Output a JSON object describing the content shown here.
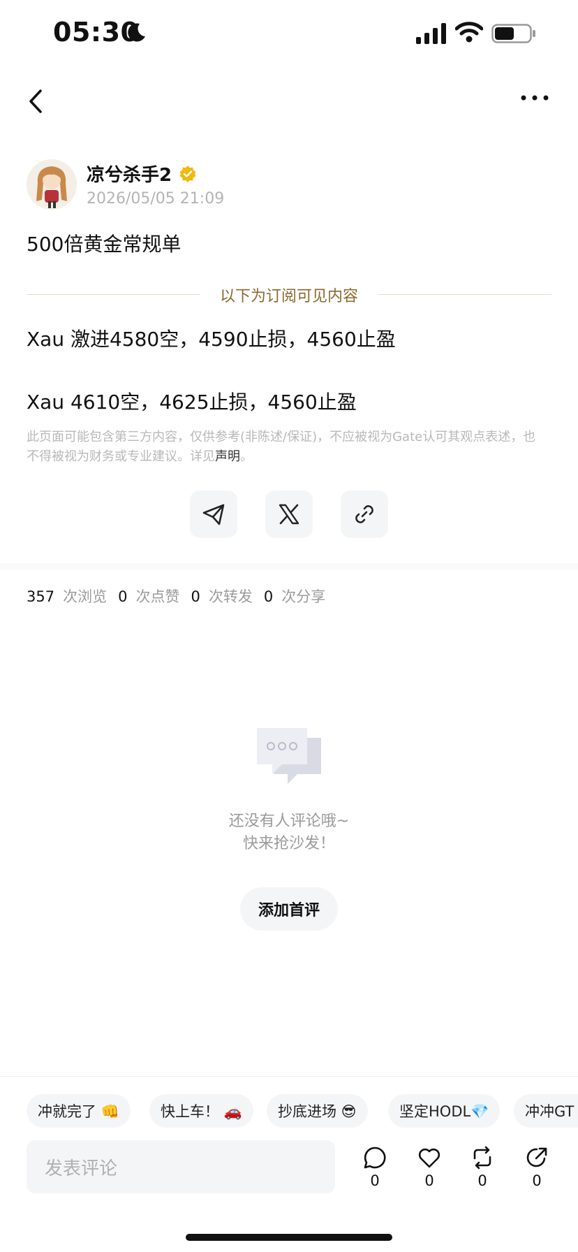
{
  "status_bar": {
    "time": "05:30"
  },
  "author": {
    "name": "凉兮杀手2",
    "time": "2026/05/05 21:09"
  },
  "post": {
    "title": "500倍黄金常规单",
    "subscriber_divider": "以下为订阅可见内容",
    "lines": [
      "Xau 激进4580空，4590止损，4560止盈",
      "Xau 4610空，4625止损，4560止盈"
    ],
    "disclaimer": "此页面可能包含第三方内容，仅供参考(非陈述/保证)，不应被视为Gate认可其观点表述，也不得被视为财务或专业建议。详见",
    "disclaimer_link": "声明",
    "disclaimer_end": "。"
  },
  "stats": {
    "views": "357",
    "views_label": "次浏览",
    "likes": "0",
    "likes_label": "次点赞",
    "reposts": "0",
    "reposts_label": "次转发",
    "shares": "0",
    "shares_label": "次分享"
  },
  "empty_comments": {
    "line1": "还没有人评论哦~",
    "line2": "快来抢沙发！",
    "button": "添加首评"
  },
  "quick_replies": [
    "冲就完了 👊",
    "快上车！ 🚗",
    "抄底进场 😎",
    "坚定HODL💎",
    "冲冲GT"
  ],
  "comment_input": {
    "placeholder": "发表评论"
  },
  "actions": {
    "comments": "0",
    "likes": "0",
    "reposts": "0",
    "shares": "0"
  },
  "icons": [
    "moon-icon",
    "signal-icon",
    "wifi-icon",
    "battery-icon",
    "back-icon",
    "more-icon",
    "verified-icon",
    "telegram-icon",
    "x-icon",
    "link-icon",
    "chat-bubbles-icon",
    "comment-icon",
    "heart-icon",
    "repost-icon",
    "share-icon"
  ],
  "colors": {
    "gold_text": "#8a6a2d",
    "verified": "#f0b90b",
    "muted": "#9a9a9a"
  }
}
